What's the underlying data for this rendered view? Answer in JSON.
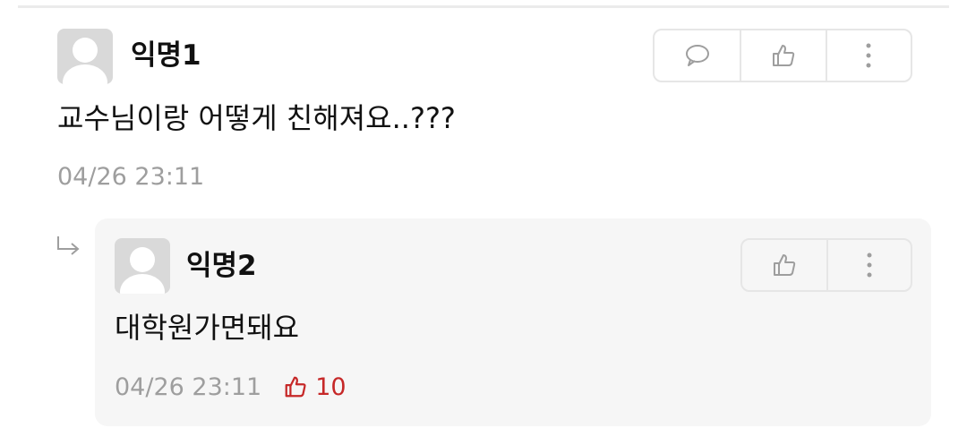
{
  "comment": {
    "author": "익명1",
    "text": "교수님이랑 어떻게 친해져요..???",
    "time": "04/26 23:11"
  },
  "reply": {
    "author": "익명2",
    "text": "대학원가면돼요",
    "time": "04/26 23:11",
    "likes": "10"
  },
  "colors": {
    "accent_red": "#c62828",
    "meta_gray": "#9e9e9e",
    "reply_bg": "#f6f6f6"
  },
  "icons": [
    "avatar-icon",
    "speech-bubble-icon",
    "thumbs-up-icon",
    "more-vertical-icon",
    "reply-arrow-icon"
  ]
}
